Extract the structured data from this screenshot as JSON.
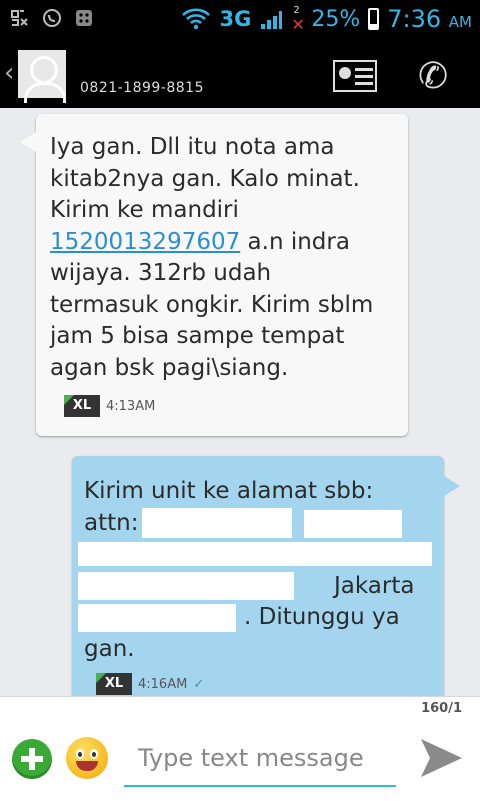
{
  "statusbar": {
    "network": "3G",
    "signal_note": "2",
    "battery": "25%",
    "battery_level": 0.25,
    "time": "7:36",
    "ampm": "AM"
  },
  "header": {
    "contact_number": "0821-1899-8815"
  },
  "messages": [
    {
      "direction": "incoming",
      "text_before_link": "Iya gan. Dll itu nota ama\nkitab2nya gan. Kalo minat.\nKirim ke mandiri\n",
      "link": "1520013297607",
      "text_after_link": " a.n indra\nwijaya. 312rb udah\ntermasuk ongkir. Kirim sblm\njam 5 bisa sampe tempat\nagan bsk pagi\\siang.",
      "carrier": "XL",
      "time": "4:13AM"
    },
    {
      "direction": "outgoing",
      "line1": "Kirim unit ke alamat sbb:",
      "line2_prefix": "attn:",
      "line2_mid": ",",
      "line4_suffix": "Jakarta",
      "line5_suffix": ". Ditunggu ya",
      "line6": "gan.",
      "carrier": "XL",
      "time": "4:16AM"
    }
  ],
  "compose": {
    "char_counter": "160/1",
    "placeholder": "Type text message"
  },
  "colors": {
    "accent": "#33b5e5",
    "outgoing_bubble": "#a4d5ee",
    "incoming_bubble": "#f8f8f8",
    "link": "#2a8fd1"
  }
}
